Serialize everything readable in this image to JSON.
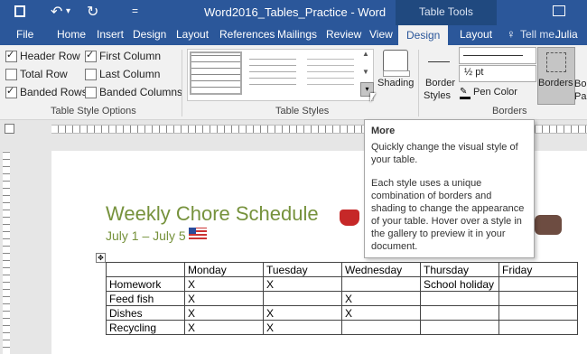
{
  "title": {
    "doc": "Word2016_Tables_Practice - Word",
    "context": "Table Tools"
  },
  "qat": {
    "undo_dropdown": "▾",
    "more": "="
  },
  "tabs": [
    "File",
    "Home",
    "Insert",
    "Design",
    "Layout",
    "References",
    "Mailings",
    "Review",
    "View",
    "Design",
    "Layout"
  ],
  "tell_me": "Tell me...",
  "user": "Julia",
  "style_options": {
    "items": [
      {
        "label": "Header Row",
        "checked": true
      },
      {
        "label": "First Column",
        "checked": true
      },
      {
        "label": "Total Row",
        "checked": false
      },
      {
        "label": "Last Column",
        "checked": false
      },
      {
        "label": "Banded Rows",
        "checked": true
      },
      {
        "label": "Banded Columns",
        "checked": false
      }
    ],
    "group_label": "Table Style Options"
  },
  "table_styles": {
    "group_label": "Table Styles",
    "shading": "Shading"
  },
  "borders": {
    "border_styles": "Border",
    "border_styles2": "Styles",
    "weight": "½ pt",
    "pen_color": "Pen Color",
    "borders": "Borders",
    "border_painter": "Bo Pai",
    "group_label": "Borders"
  },
  "tooltip": {
    "title": "More",
    "line1": "Quickly change the visual style of",
    "line2": "your table.",
    "p1": "Each style uses a unique",
    "p2": "combination of borders and",
    "p3": "shading to change the appearance",
    "p4": "of your table. Hover over a style in",
    "p5": "the gallery to preview it in your",
    "p6": "document."
  },
  "document": {
    "heading": "Weekly Chore Schedule",
    "dates": "July 1 – July 5",
    "table_header": [
      "",
      "Monday",
      "Tuesday",
      "Wednesday",
      "Thursday",
      "Friday"
    ],
    "rows": [
      [
        "Homework",
        "X",
        "X",
        "",
        "School holiday",
        ""
      ],
      [
        "Feed fish",
        "X",
        "",
        "X",
        "",
        ""
      ],
      [
        "Dishes",
        "X",
        "X",
        "X",
        "",
        ""
      ],
      [
        "Recycling",
        "X",
        "X",
        "",
        "",
        ""
      ]
    ]
  },
  "colors": {
    "accent": "#2b579a",
    "heading": "#76923c"
  }
}
